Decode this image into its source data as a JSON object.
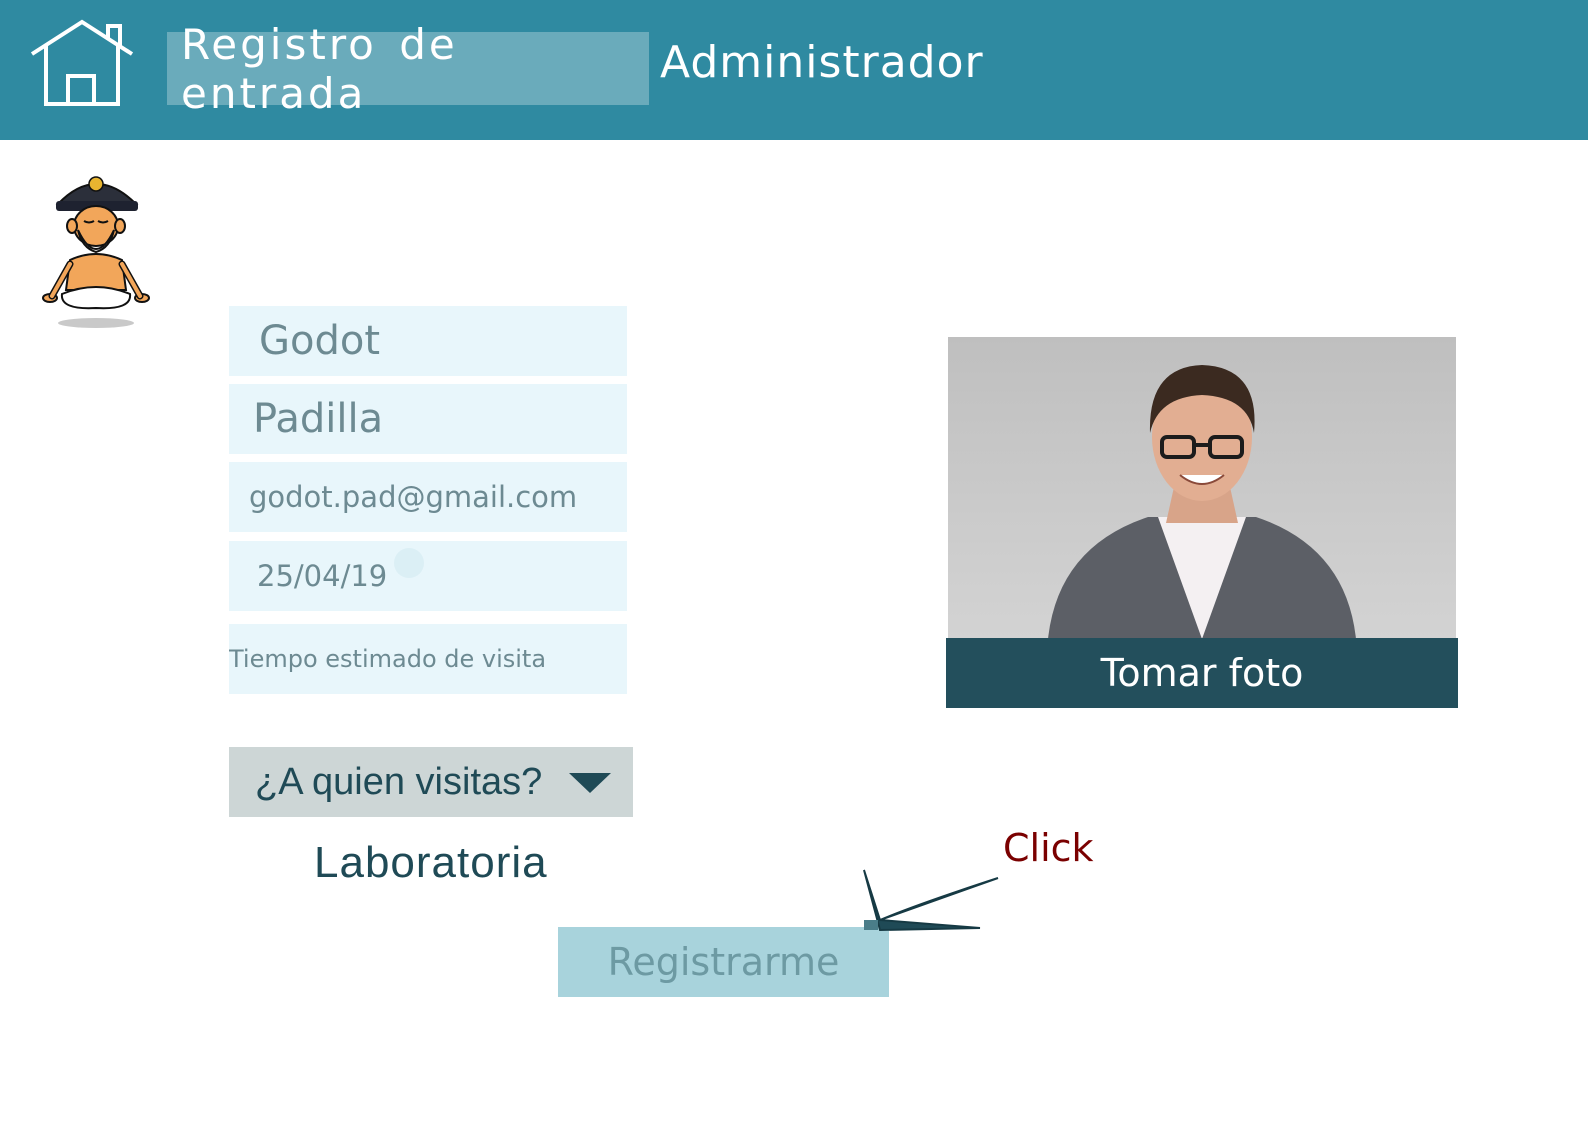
{
  "header": {
    "active_tab": "Registro de entrada",
    "admin_tab": "Administrador",
    "background_color": "#2f8aa1"
  },
  "form": {
    "first_name": "Godot",
    "last_name": "Padilla",
    "email": "godot.pad@gmail.com",
    "date": "25/04/19",
    "visit_time_placeholder": "Tiempo estimado de visita",
    "visit_select_label": "¿A quien visitas?",
    "visit_selected_value": "Laboratoria",
    "field_background": "#e8f6fb"
  },
  "photo": {
    "button_label": "Tomar foto",
    "button_color": "#234f5c"
  },
  "register": {
    "button_label": "Registrarme",
    "button_color": "#a8d3dc"
  },
  "annotation": {
    "label": "Click",
    "color": "#7a0000"
  },
  "icons": {
    "home": "home-icon",
    "mascot": "police-mascot-icon",
    "dropdown": "chevron-down-icon",
    "pointer": "arrow-pointer-icon"
  }
}
